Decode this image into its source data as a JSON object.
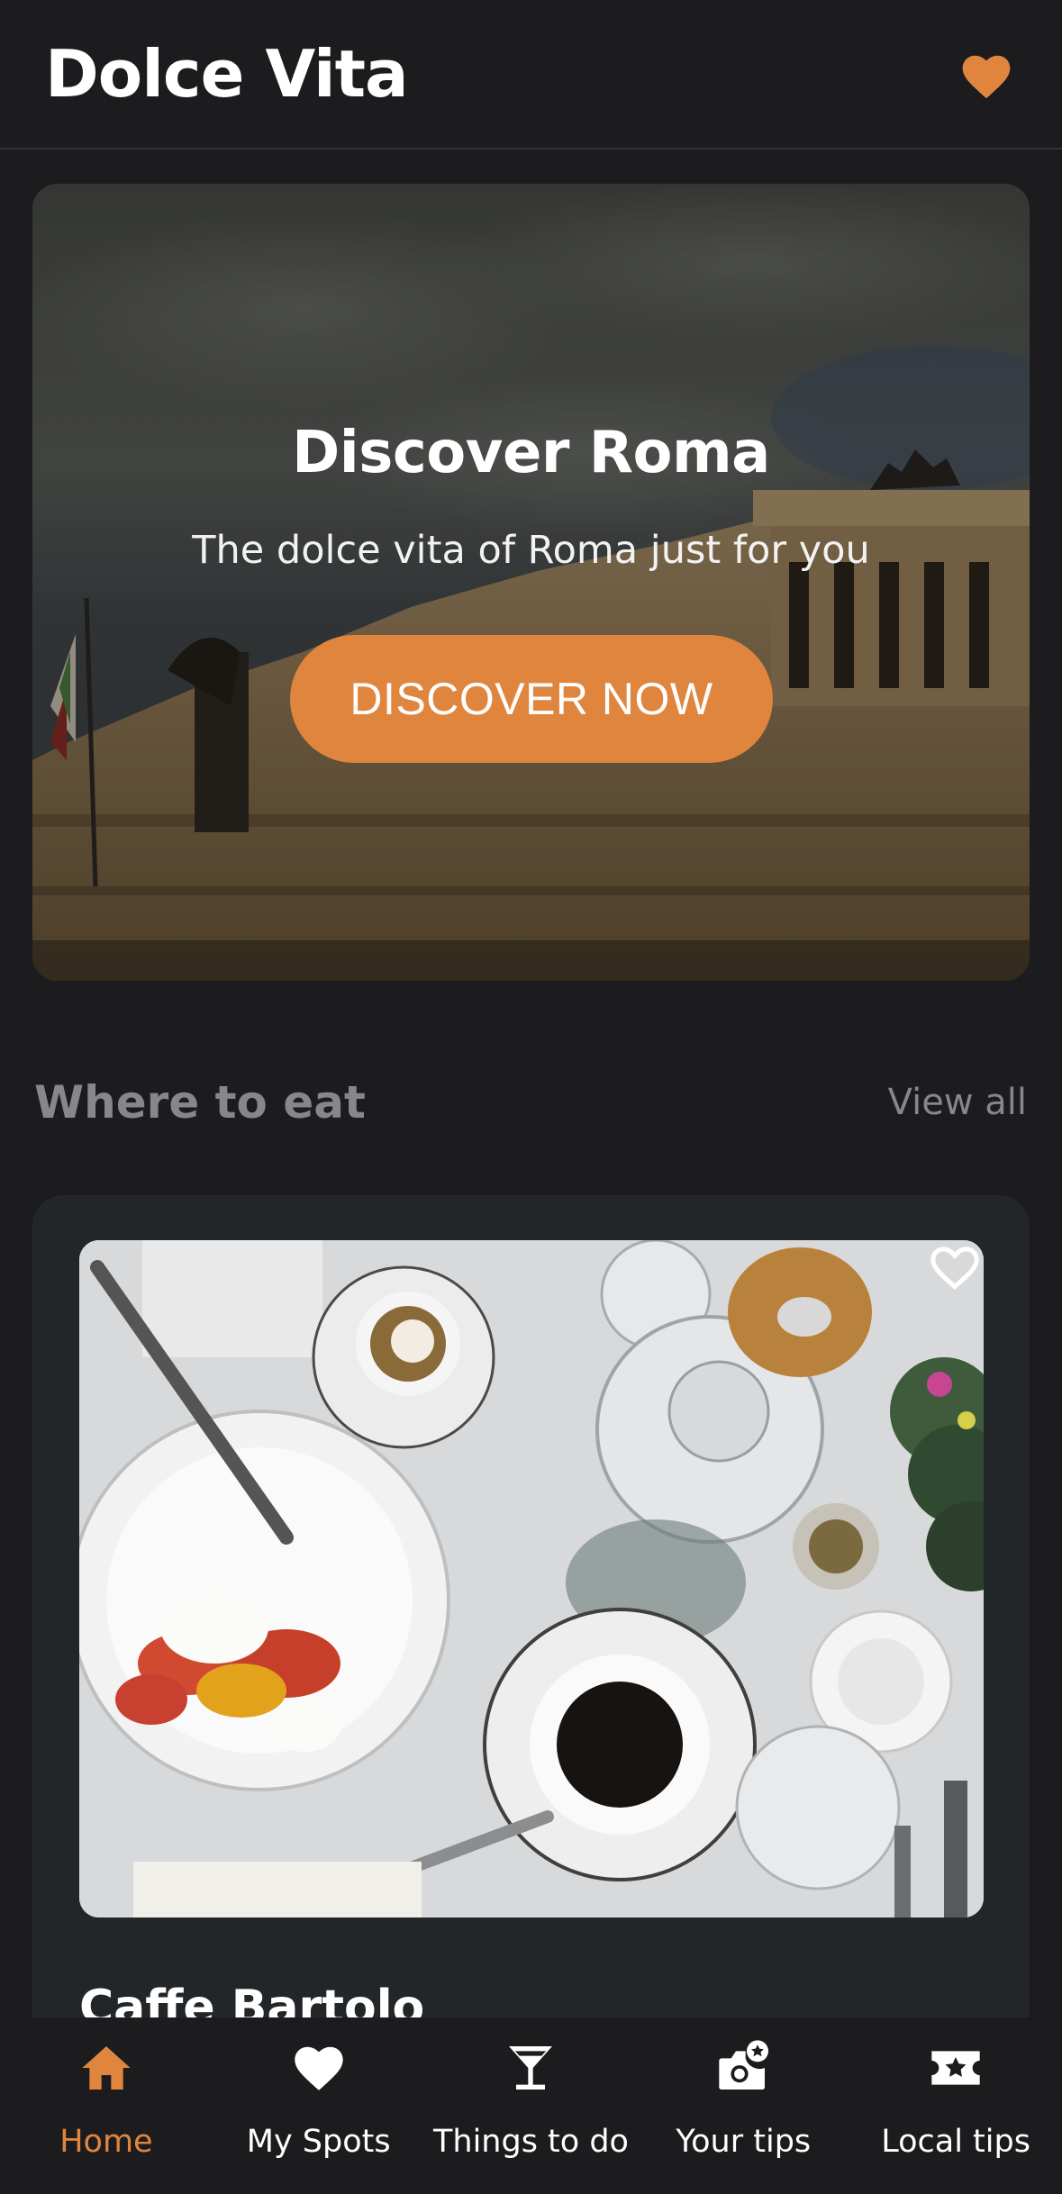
{
  "header": {
    "title": "Dolce Vita",
    "favorites_icon": "heart-icon"
  },
  "hero": {
    "title": "Discover Roma",
    "subtitle": "The dolce vita of Roma just for you",
    "button_label": "DISCOVER NOW"
  },
  "section": {
    "title": "Where to eat",
    "view_all": "View all"
  },
  "card": {
    "name": "Caffe Bartolo",
    "favorite_icon": "heart-outline-icon"
  },
  "nav": {
    "items": [
      {
        "label": "Home",
        "icon": "home-icon",
        "active": true
      },
      {
        "label": "My Spots",
        "icon": "heart-icon",
        "active": false
      },
      {
        "label": "Things to do",
        "icon": "cocktail-icon",
        "active": false
      },
      {
        "label": "Your tips",
        "icon": "photo-star-icon",
        "active": false
      },
      {
        "label": "Local tips",
        "icon": "ticket-star-icon",
        "active": false
      }
    ]
  },
  "colors": {
    "accent": "#e0853e",
    "background": "#1c1c1e",
    "card": "#232628",
    "muted": "#86868b"
  }
}
